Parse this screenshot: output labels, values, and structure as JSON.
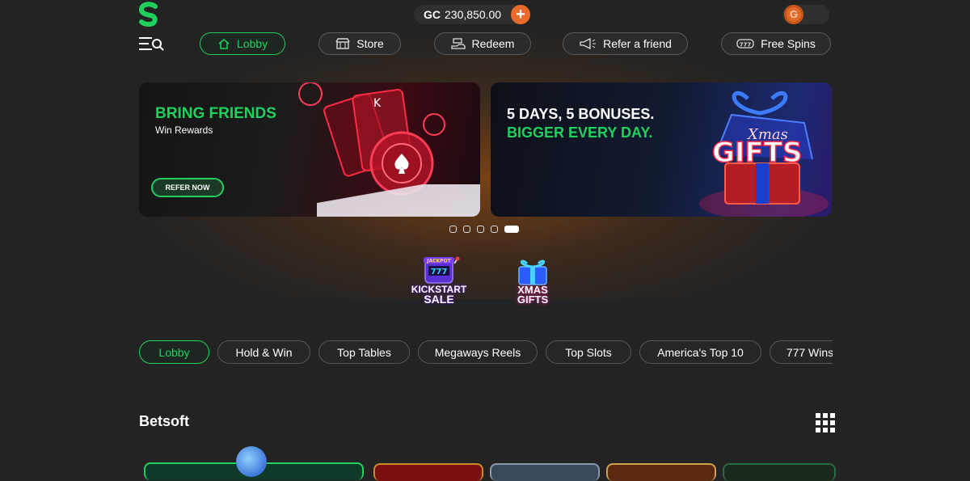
{
  "header": {
    "balance_currency": "GC",
    "balance_amount": "230,850.00",
    "add_symbol": "+",
    "coin_letter": "G"
  },
  "nav": [
    {
      "label": "Lobby",
      "icon": "home-icon",
      "active": true
    },
    {
      "label": "Store",
      "icon": "store-icon",
      "active": false
    },
    {
      "label": "Redeem",
      "icon": "redeem-icon",
      "active": false
    },
    {
      "label": "Refer a friend",
      "icon": "megaphone-icon",
      "active": false
    },
    {
      "label": "Free Spins",
      "icon": "slot-777-icon",
      "active": false
    }
  ],
  "banners": {
    "refer": {
      "title": "BRING FRIENDS",
      "subtitle": "Win Rewards",
      "cta": "REFER NOW"
    },
    "xmas": {
      "line1": "5 DAYS, 5 BONUSES.",
      "line2": "BIGGER EVERY DAY.",
      "art_text_1": "Xmas",
      "art_text_2": "GIFTS"
    }
  },
  "carousel": {
    "total": 5,
    "active_index": 4
  },
  "promos": [
    {
      "line1": "KICKSTART",
      "line2": "SALE",
      "badge": "JACKPOT",
      "reels": "777"
    },
    {
      "line1": "XMAS",
      "line2": "GIFTS"
    }
  ],
  "categories": [
    {
      "label": "Lobby",
      "active": true
    },
    {
      "label": "Hold & Win",
      "active": false
    },
    {
      "label": "Top Tables",
      "active": false
    },
    {
      "label": "Megaways Reels",
      "active": false
    },
    {
      "label": "Top Slots",
      "active": false
    },
    {
      "label": "America's Top 10",
      "active": false
    },
    {
      "label": "777 Wins",
      "active": false
    }
  ],
  "section": {
    "title": "Betsoft"
  },
  "colors": {
    "accent": "#1fd05e",
    "orange": "#e96a2b",
    "background": "#232323"
  }
}
